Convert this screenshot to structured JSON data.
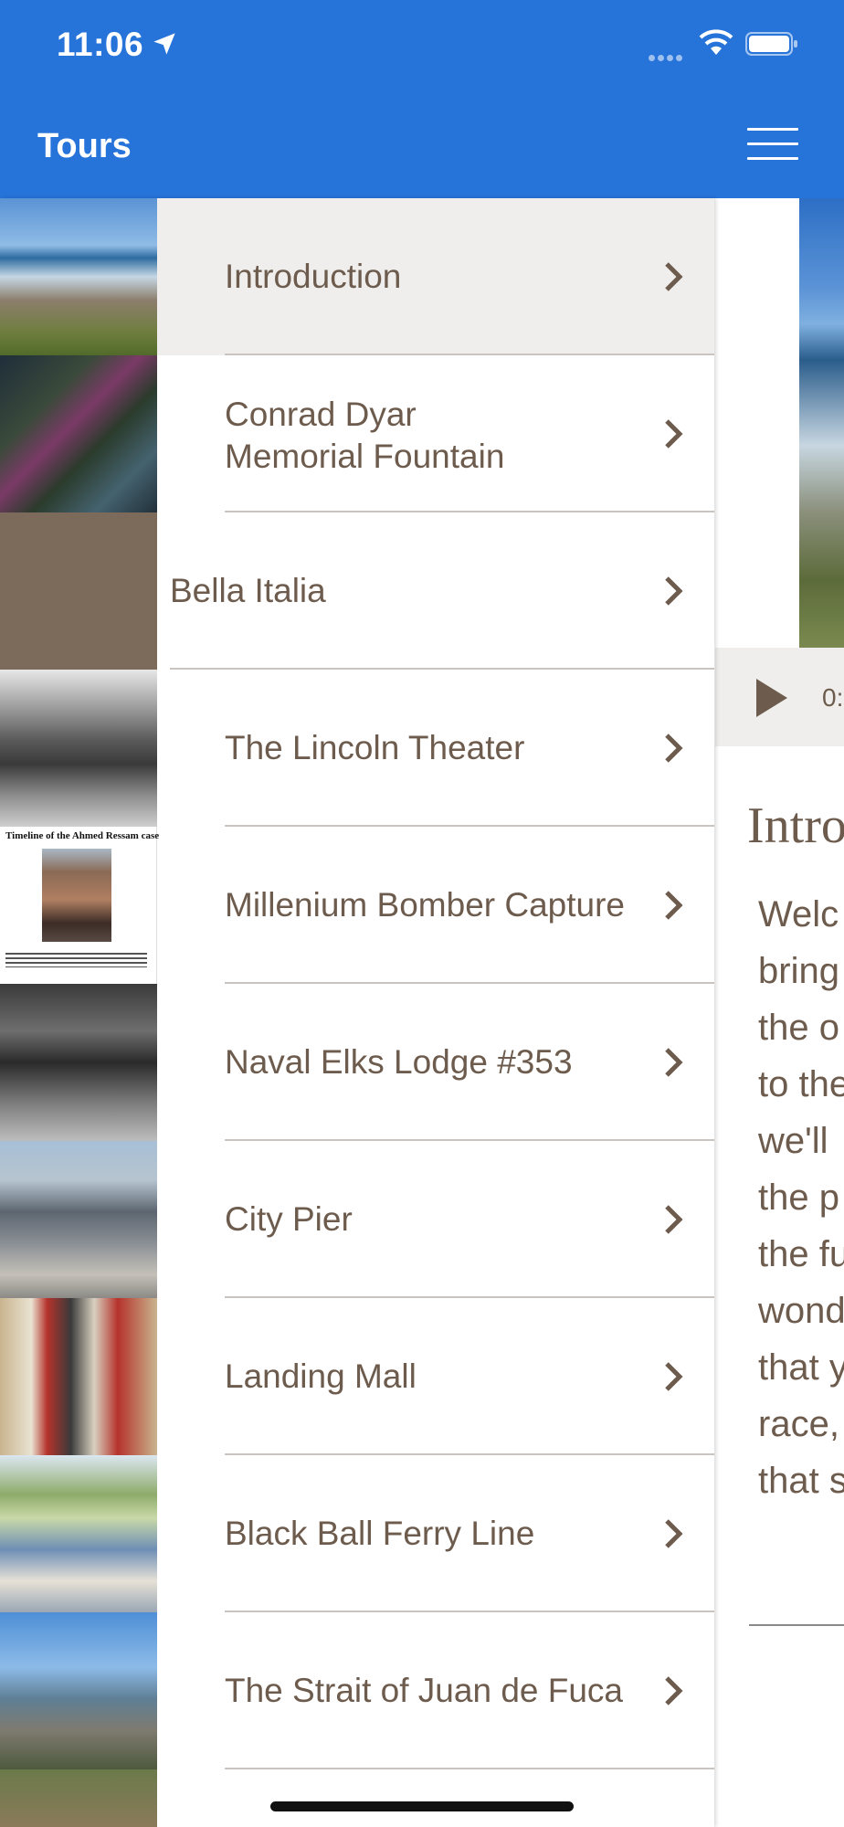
{
  "status_bar": {
    "time": "11:06"
  },
  "nav": {
    "title": "Tours"
  },
  "colors": {
    "nav_blue": "#2673d9",
    "text_brown": "#6d5c4d",
    "selected_bg": "#efeeec"
  },
  "menu": {
    "items": [
      {
        "label": "Introduction",
        "thumb": "waterfront-town-photo",
        "selected": true
      },
      {
        "label": "Conrad Dyar\nMemorial Fountain",
        "thumb": "fountain-flowers-photo"
      },
      {
        "label": "Bella Italia",
        "thumb": "plain-brown-tile"
      },
      {
        "label": "The Lincoln Theater",
        "thumb": "theater-bw-photo"
      },
      {
        "label": "Millenium Bomber Capture",
        "thumb": "newspaper-clipping"
      },
      {
        "label": "Naval Elks Lodge #353",
        "thumb": "lodge-interior-bw-photo"
      },
      {
        "label": "City Pier",
        "thumb": "pier-old-photo"
      },
      {
        "label": "Landing Mall",
        "thumb": "totem-poles-photo"
      },
      {
        "label": "Black Ball Ferry Line",
        "thumb": "ferry-terminal-sketch"
      },
      {
        "label": "The Strait of Juan de Fuca",
        "thumb": "waterfront-walkway-photo"
      }
    ],
    "thumb_caption": {
      "title": "Timeline of the Ahmed Ressam case"
    }
  },
  "detail": {
    "audio_time": "0:",
    "heading": "Intro",
    "body_lines": [
      "Welc",
      "bring",
      "the o",
      "to the",
      "we'll",
      "the p",
      "the fu",
      "wond",
      "that y",
      "race,",
      "that s"
    ]
  }
}
